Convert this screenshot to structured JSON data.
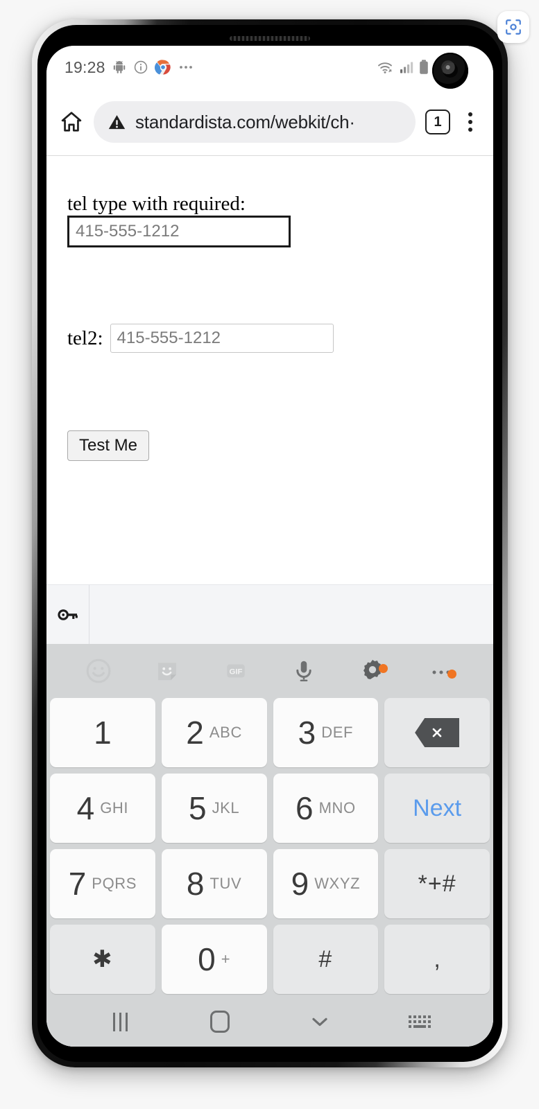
{
  "capture": {
    "icon": "screenshot-capture-icon"
  },
  "status_bar": {
    "time": "19:28",
    "left_icons": [
      "android-robot-icon",
      "info-circle-icon",
      "chrome-logo-icon",
      "more-notifications-icon"
    ],
    "right_icons": [
      "wifi-icon",
      "cellular-signal-icon",
      "battery-icon"
    ]
  },
  "browser": {
    "home_icon": "home-icon",
    "security_icon": "not-secure-warning-icon",
    "url": "standardista.com/webkit/ch·",
    "tab_count": "1",
    "menu_icon": "kebab-menu-icon"
  },
  "page": {
    "fields": [
      {
        "label": "tel type with required:",
        "value": "415-555-1212",
        "placeholder": "415-555-1212",
        "focused": true
      },
      {
        "label": "tel2:",
        "value": "415-555-1212",
        "placeholder": "415-555-1212",
        "focused": false
      }
    ],
    "submit_label": "Test Me"
  },
  "suggestion_strip": {
    "icon": "password-key-icon"
  },
  "keyboard": {
    "toolbar": [
      {
        "icon": "emoji-smiley-icon",
        "badge": false
      },
      {
        "icon": "sticker-icon",
        "badge": false
      },
      {
        "icon": "gif-icon",
        "badge": false
      },
      {
        "icon": "microphone-icon",
        "badge": false
      },
      {
        "icon": "settings-gear-icon",
        "badge": true
      },
      {
        "icon": "more-options-icon",
        "badge": true
      }
    ],
    "rows": [
      [
        {
          "type": "num",
          "digit": "1",
          "letters": ""
        },
        {
          "type": "num",
          "digit": "2",
          "letters": "ABC"
        },
        {
          "type": "num",
          "digit": "3",
          "letters": "DEF"
        },
        {
          "type": "fn",
          "kind": "backspace",
          "label": ""
        }
      ],
      [
        {
          "type": "num",
          "digit": "4",
          "letters": "GHI"
        },
        {
          "type": "num",
          "digit": "5",
          "letters": "JKL"
        },
        {
          "type": "num",
          "digit": "6",
          "letters": "MNO"
        },
        {
          "type": "fn",
          "kind": "next",
          "label": "Next"
        }
      ],
      [
        {
          "type": "num",
          "digit": "7",
          "letters": "PQRS"
        },
        {
          "type": "num",
          "digit": "8",
          "letters": "TUV"
        },
        {
          "type": "num",
          "digit": "9",
          "letters": "WXYZ"
        },
        {
          "type": "fn",
          "kind": "sym",
          "label": "*+#"
        }
      ],
      [
        {
          "type": "fn",
          "kind": "sym",
          "label": "✱"
        },
        {
          "type": "num",
          "digit": "0",
          "letters": "+"
        },
        {
          "type": "fn",
          "kind": "sym",
          "label": "#"
        },
        {
          "type": "fn",
          "kind": "comma",
          "label": ","
        }
      ]
    ]
  },
  "nav_bar": {
    "items": [
      "recents-icon",
      "home-icon",
      "hide-keyboard-icon",
      "keyboard-switch-icon"
    ]
  },
  "colors": {
    "accent_blue": "#5a9bec",
    "badge_orange": "#f07523",
    "keyboard_bg": "#d3d5d6",
    "key_bg": "#fbfbfb",
    "fn_key_bg": "#e7e8e9"
  }
}
